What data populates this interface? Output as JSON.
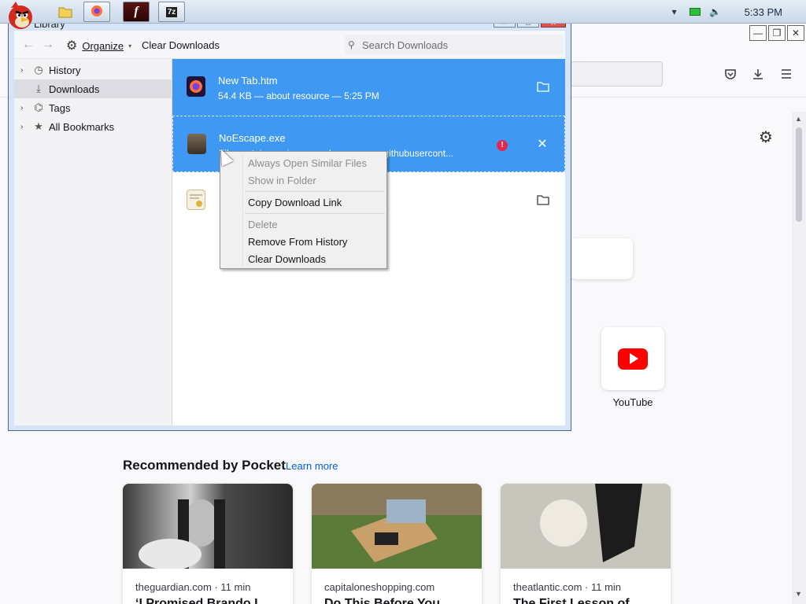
{
  "taskbar": {
    "apps": [
      {
        "name": "firefox",
        "icon": "firefox-icon"
      },
      {
        "name": "flash",
        "icon": "flash-icon",
        "glyph": "f"
      },
      {
        "name": "7zip",
        "icon": "7zip-icon",
        "glyph": "7z"
      }
    ],
    "clock": "5:33 PM"
  },
  "browser": {
    "pocket": {
      "title": "Recommended by Pocket",
      "learn_more": "Learn more",
      "cards": [
        {
          "source": "theguardian.com · 11 min",
          "headline": "‘I Promised Brando I"
        },
        {
          "source": "capitaloneshopping.com",
          "headline": "Do This Before You"
        },
        {
          "source": "theatlantic.com · 11 min",
          "headline": "The First Lesson of"
        }
      ]
    },
    "shortcuts": [
      {
        "label": "YouTube"
      }
    ]
  },
  "library": {
    "title": "Library",
    "toolbar": {
      "organize": "Organize",
      "clear_downloads": "Clear Downloads",
      "search_placeholder": "Search Downloads"
    },
    "sidebar": [
      {
        "label": "History",
        "icon": "clock-icon",
        "twisty": true
      },
      {
        "label": "Downloads",
        "icon": "download-icon",
        "twisty": false,
        "selected": true
      },
      {
        "label": "Tags",
        "icon": "tag-icon",
        "twisty": true
      },
      {
        "label": "All Bookmarks",
        "icon": "star-icon",
        "twisty": true
      }
    ],
    "downloads": [
      {
        "name": "New Tab.htm",
        "status": "54.4 KB — about resource — 5:25 PM",
        "action": "folder-icon"
      },
      {
        "name": "NoEscape.exe",
        "status": "File contains a virus or malware — raw.githubusercont...",
        "action": "close-icon",
        "warning": "!"
      },
      {
        "name": "",
        "status": "",
        "action": "folder-icon"
      }
    ]
  },
  "context_menu": {
    "items": [
      {
        "label": "Always Open Similar Files",
        "disabled": true
      },
      {
        "label": "Show in Folder",
        "disabled": true
      },
      {
        "sep": true
      },
      {
        "label": "Copy Download Link",
        "disabled": false
      },
      {
        "sep": true
      },
      {
        "label": "Delete",
        "disabled": true
      },
      {
        "label": "Remove From History",
        "disabled": false
      },
      {
        "label": "Clear Downloads",
        "disabled": false
      }
    ]
  },
  "colors": {
    "selection": "#3f99f2",
    "link": "#0060df",
    "warning": "#e22850"
  }
}
